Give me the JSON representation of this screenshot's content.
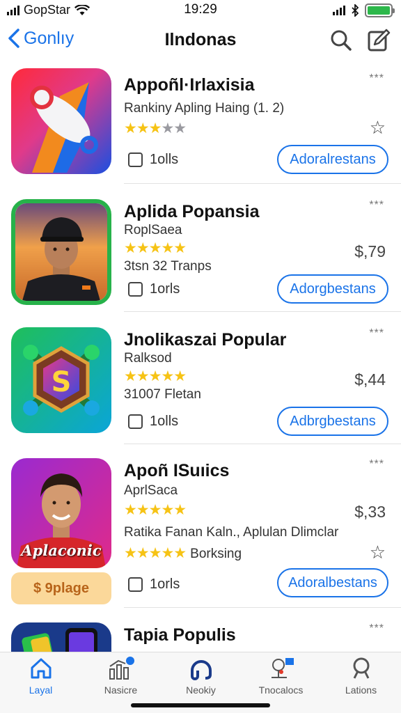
{
  "status_bar": {
    "carrier": "GopStar",
    "time": "19:29"
  },
  "nav": {
    "back_label": "Gonlıy",
    "title": "Ilndonas"
  },
  "apps": [
    {
      "name": "Appoñl·Irlaxisia",
      "subtitle": "Rankiny Apling Haing (1. 2)",
      "rating": 2.5,
      "stars_on": "★★★",
      "stars_off": "★★",
      "checkbox_label": "1olls",
      "button_label": "Adoralrestans",
      "more": "***",
      "favorite": "☆"
    },
    {
      "name": "Aplida Popansia",
      "subtitle": "RoplSaea",
      "rating": 5,
      "stars_on": "★★★★★",
      "info": "3tsn 32 Tranps",
      "price": "$,79",
      "checkbox_label": "1orls",
      "button_label": "Adorgbestans",
      "more": "***"
    },
    {
      "name": "Jnolikaszai Popular",
      "subtitle": "Ralksod",
      "rating": 5,
      "stars_on": "★★★★★",
      "info": "31007 Fletan",
      "price": "$,44",
      "checkbox_label": "1olls",
      "button_label": "Adbrgbestans",
      "more": "***"
    },
    {
      "name": "Apoñ ISuıics",
      "subtitle": "AprlSaca",
      "rating": 5,
      "stars_on": "★★★★★",
      "info": "Ratika Fanan Kaln., Aplulan Dlimclar",
      "extra_stars": "★★★★★",
      "extra_label": "Borksing",
      "price": "$,33",
      "checkbox_label": "1orls",
      "button_label": "Adoralbestans",
      "more": "***",
      "favorite": "☆",
      "icon_caption": "Aplaconic",
      "badge_label": "$ 9plage"
    },
    {
      "name": "Tapia Populis",
      "more": "***"
    }
  ],
  "tabs": [
    {
      "label": "Layal",
      "icon": "home-icon",
      "active": true
    },
    {
      "label": "Nasicre",
      "icon": "chart-icon"
    },
    {
      "label": "Neokiy",
      "icon": "headset-icon"
    },
    {
      "label": "Tnocalocs",
      "icon": "location-icon"
    },
    {
      "label": "Lations",
      "icon": "search-icon"
    }
  ],
  "colors": {
    "accent": "#1a73e8",
    "star": "#f6c315",
    "battery": "#2db84b"
  }
}
